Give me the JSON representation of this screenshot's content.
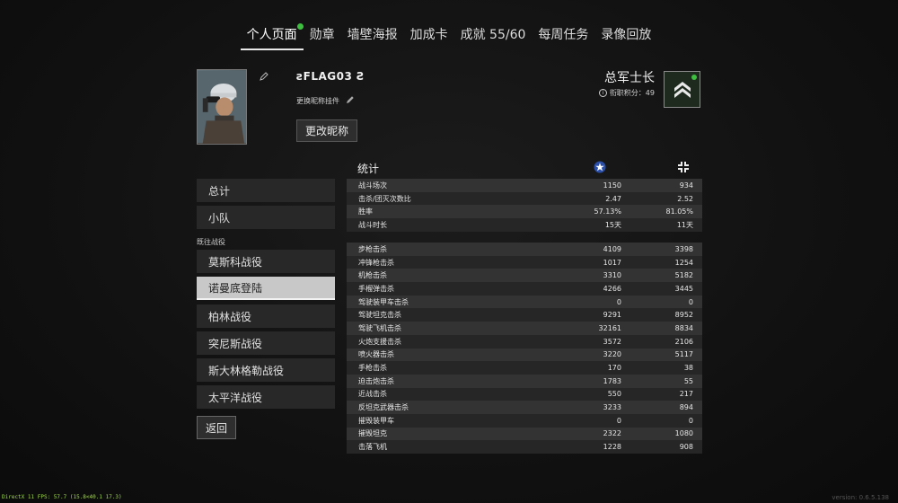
{
  "nav": {
    "tabs": [
      "个人页面",
      "勋章",
      "墙壁海报",
      "加成卡",
      "成就 55/60",
      "每周任务",
      "录像回放"
    ],
    "active_index": 0,
    "badge": "!"
  },
  "profile": {
    "nickname": "FLAG03",
    "nick_style_label": "更换昵称挂件",
    "rename_button": "更改昵称",
    "rank_title": "总军士长",
    "rank_score": "衔职积分：49"
  },
  "menu": {
    "items_top": [
      "总计",
      "小队"
    ],
    "section_label": "既往战役",
    "campaigns": [
      "莫斯科战役",
      "诺曼底登陆",
      "柏林战役",
      "突尼斯战役",
      "斯大林格勒战役",
      "太平洋战役"
    ],
    "active_campaign_index": 1,
    "back_button": "返回"
  },
  "stats": {
    "title": "统计",
    "summary": [
      {
        "label": "战斗场次",
        "allies": "1150",
        "axis": "934"
      },
      {
        "label": "击杀/团灭次数比",
        "allies": "2.47",
        "axis": "2.52"
      },
      {
        "label": "胜率",
        "allies": "57.13%",
        "axis": "81.05%"
      },
      {
        "label": "战斗时长",
        "allies": "15天",
        "axis": "11天"
      }
    ],
    "kills": [
      {
        "label": "步枪击杀",
        "allies": "4109",
        "axis": "3398"
      },
      {
        "label": "冲锋枪击杀",
        "allies": "1017",
        "axis": "1254"
      },
      {
        "label": "机枪击杀",
        "allies": "3310",
        "axis": "5182"
      },
      {
        "label": "手榴弹击杀",
        "allies": "4266",
        "axis": "3445"
      },
      {
        "label": "驾驶装甲车击杀",
        "allies": "0",
        "axis": "0"
      },
      {
        "label": "驾驶坦克击杀",
        "allies": "9291",
        "axis": "8952"
      },
      {
        "label": "驾驶飞机击杀",
        "allies": "32161",
        "axis": "8834"
      },
      {
        "label": "火炮支援击杀",
        "allies": "3572",
        "axis": "2106"
      },
      {
        "label": "喷火器击杀",
        "allies": "3220",
        "axis": "5117"
      },
      {
        "label": "手枪击杀",
        "allies": "170",
        "axis": "38"
      },
      {
        "label": "迫击炮击杀",
        "allies": "1783",
        "axis": "55"
      },
      {
        "label": "近战击杀",
        "allies": "550",
        "axis": "217"
      },
      {
        "label": "反坦克武器击杀",
        "allies": "3233",
        "axis": "894"
      },
      {
        "label": "摧毁装甲车",
        "allies": "0",
        "axis": "0"
      },
      {
        "label": "摧毁坦克",
        "allies": "2322",
        "axis": "1080"
      },
      {
        "label": "击落飞机",
        "allies": "1228",
        "axis": "908"
      }
    ]
  },
  "footer": {
    "fps": "DirectX 11 FPS: 57.7 (15.8<40.1 17.3)",
    "version": "version: 0.6.5.138"
  },
  "colors": {
    "badge_green": "#3fbf3f",
    "active_menu_bg": "#c8c8c8",
    "fps_text": "#9fd84a"
  }
}
